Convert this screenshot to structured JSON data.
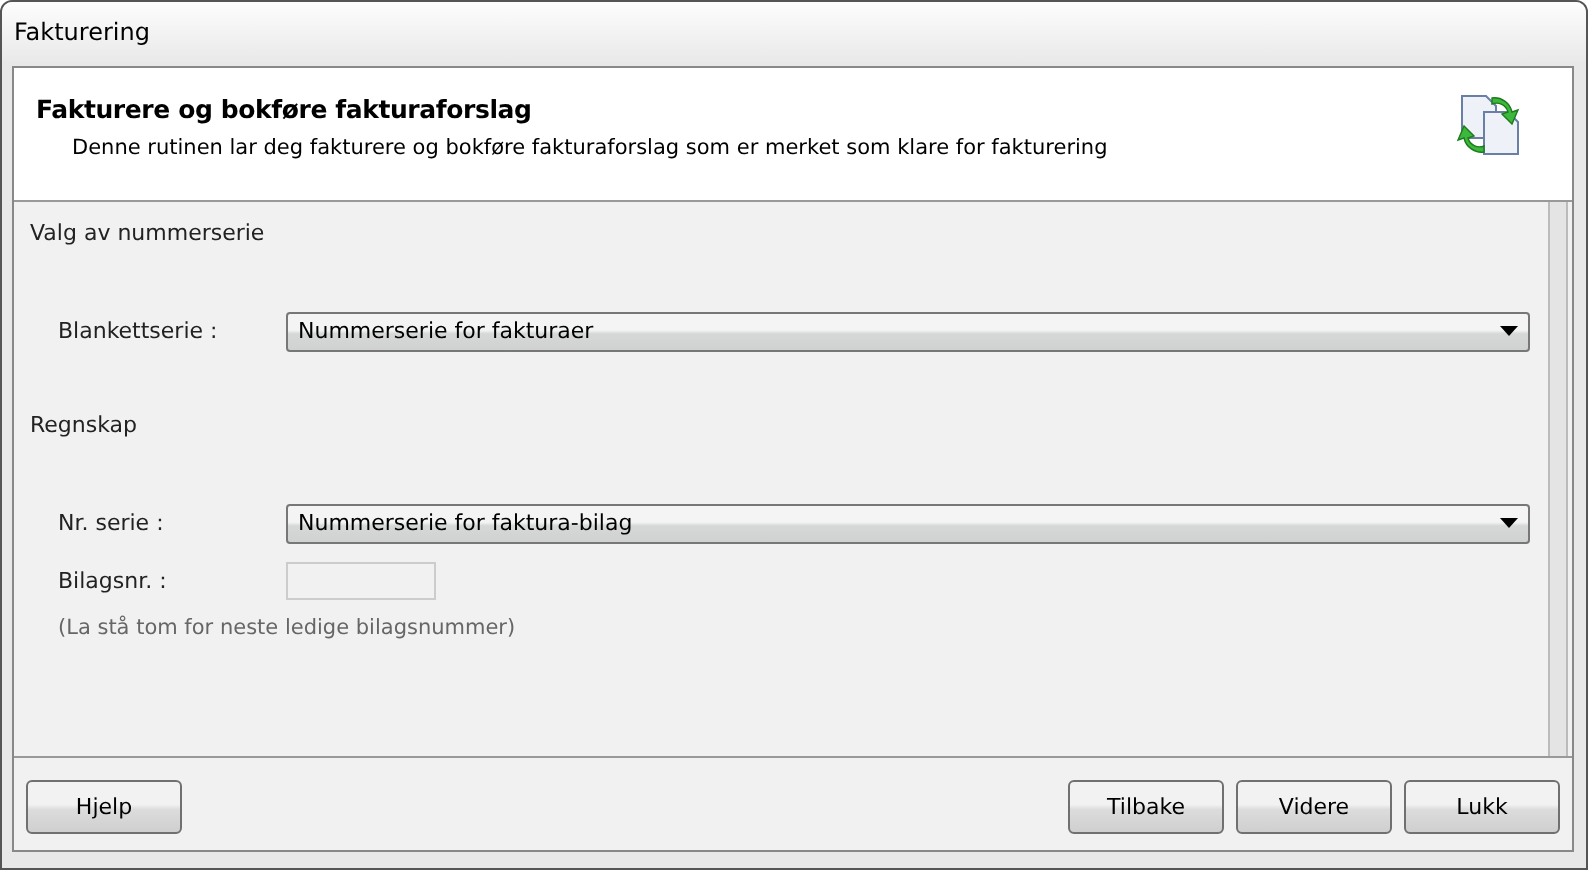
{
  "window": {
    "title": "Fakturering"
  },
  "header": {
    "title": "Fakturere og bokføre fakturaforslag",
    "description": "Denne rutinen lar deg fakturere og bokføre fakturaforslag som er merket som klare for fakturering"
  },
  "sections": [
    {
      "heading": "Valg av nummerserie",
      "fields": [
        {
          "kind": "dropdown",
          "label": "Blankettserie :",
          "value": "Nummerserie for fakturaer"
        }
      ]
    },
    {
      "heading": "Regnskap",
      "fields": [
        {
          "kind": "dropdown",
          "label": "Nr. serie :",
          "value": "Nummerserie for faktura-bilag"
        },
        {
          "kind": "text",
          "label": "Bilagsnr. :",
          "disabled": true
        }
      ]
    }
  ],
  "hint": "(La stå tom for neste ledige bilagsnummer)",
  "buttons_left": [
    "Hjelp"
  ],
  "buttons_right": [
    "Tilbake",
    "Videre",
    "Lukk"
  ]
}
